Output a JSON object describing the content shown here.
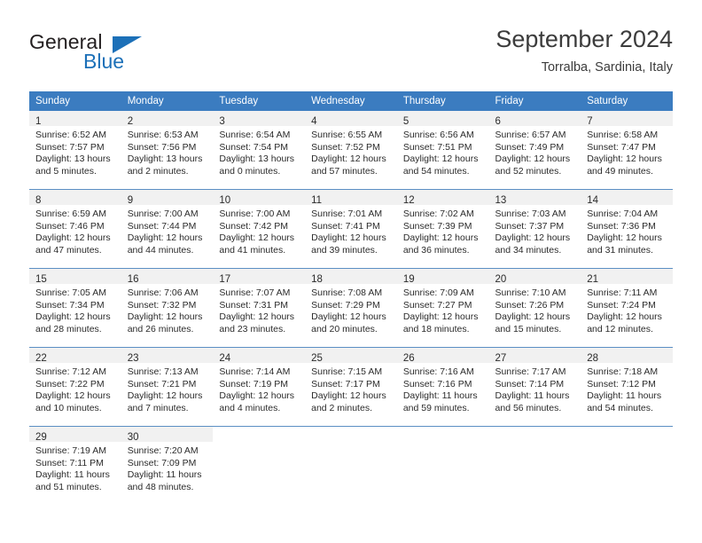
{
  "brand": {
    "name_part1": "General",
    "name_part2": "Blue",
    "triangle_icon": "triangle-icon",
    "accent_color": "#1c70b8"
  },
  "header": {
    "title": "September 2024",
    "subtitle": "Torralba, Sardinia, Italy"
  },
  "theme": {
    "header_blue": "#3b7cc0",
    "daynum_band": "#f1f1f1",
    "row_border": "#5b8fc4"
  },
  "weekdays": [
    "Sunday",
    "Monday",
    "Tuesday",
    "Wednesday",
    "Thursday",
    "Friday",
    "Saturday"
  ],
  "weeks": [
    [
      {
        "day": "1",
        "sunrise": "Sunrise: 6:52 AM",
        "sunset": "Sunset: 7:57 PM",
        "daylight1": "Daylight: 13 hours",
        "daylight2": "and 5 minutes."
      },
      {
        "day": "2",
        "sunrise": "Sunrise: 6:53 AM",
        "sunset": "Sunset: 7:56 PM",
        "daylight1": "Daylight: 13 hours",
        "daylight2": "and 2 minutes."
      },
      {
        "day": "3",
        "sunrise": "Sunrise: 6:54 AM",
        "sunset": "Sunset: 7:54 PM",
        "daylight1": "Daylight: 13 hours",
        "daylight2": "and 0 minutes."
      },
      {
        "day": "4",
        "sunrise": "Sunrise: 6:55 AM",
        "sunset": "Sunset: 7:52 PM",
        "daylight1": "Daylight: 12 hours",
        "daylight2": "and 57 minutes."
      },
      {
        "day": "5",
        "sunrise": "Sunrise: 6:56 AM",
        "sunset": "Sunset: 7:51 PM",
        "daylight1": "Daylight: 12 hours",
        "daylight2": "and 54 minutes."
      },
      {
        "day": "6",
        "sunrise": "Sunrise: 6:57 AM",
        "sunset": "Sunset: 7:49 PM",
        "daylight1": "Daylight: 12 hours",
        "daylight2": "and 52 minutes."
      },
      {
        "day": "7",
        "sunrise": "Sunrise: 6:58 AM",
        "sunset": "Sunset: 7:47 PM",
        "daylight1": "Daylight: 12 hours",
        "daylight2": "and 49 minutes."
      }
    ],
    [
      {
        "day": "8",
        "sunrise": "Sunrise: 6:59 AM",
        "sunset": "Sunset: 7:46 PM",
        "daylight1": "Daylight: 12 hours",
        "daylight2": "and 47 minutes."
      },
      {
        "day": "9",
        "sunrise": "Sunrise: 7:00 AM",
        "sunset": "Sunset: 7:44 PM",
        "daylight1": "Daylight: 12 hours",
        "daylight2": "and 44 minutes."
      },
      {
        "day": "10",
        "sunrise": "Sunrise: 7:00 AM",
        "sunset": "Sunset: 7:42 PM",
        "daylight1": "Daylight: 12 hours",
        "daylight2": "and 41 minutes."
      },
      {
        "day": "11",
        "sunrise": "Sunrise: 7:01 AM",
        "sunset": "Sunset: 7:41 PM",
        "daylight1": "Daylight: 12 hours",
        "daylight2": "and 39 minutes."
      },
      {
        "day": "12",
        "sunrise": "Sunrise: 7:02 AM",
        "sunset": "Sunset: 7:39 PM",
        "daylight1": "Daylight: 12 hours",
        "daylight2": "and 36 minutes."
      },
      {
        "day": "13",
        "sunrise": "Sunrise: 7:03 AM",
        "sunset": "Sunset: 7:37 PM",
        "daylight1": "Daylight: 12 hours",
        "daylight2": "and 34 minutes."
      },
      {
        "day": "14",
        "sunrise": "Sunrise: 7:04 AM",
        "sunset": "Sunset: 7:36 PM",
        "daylight1": "Daylight: 12 hours",
        "daylight2": "and 31 minutes."
      }
    ],
    [
      {
        "day": "15",
        "sunrise": "Sunrise: 7:05 AM",
        "sunset": "Sunset: 7:34 PM",
        "daylight1": "Daylight: 12 hours",
        "daylight2": "and 28 minutes."
      },
      {
        "day": "16",
        "sunrise": "Sunrise: 7:06 AM",
        "sunset": "Sunset: 7:32 PM",
        "daylight1": "Daylight: 12 hours",
        "daylight2": "and 26 minutes."
      },
      {
        "day": "17",
        "sunrise": "Sunrise: 7:07 AM",
        "sunset": "Sunset: 7:31 PM",
        "daylight1": "Daylight: 12 hours",
        "daylight2": "and 23 minutes."
      },
      {
        "day": "18",
        "sunrise": "Sunrise: 7:08 AM",
        "sunset": "Sunset: 7:29 PM",
        "daylight1": "Daylight: 12 hours",
        "daylight2": "and 20 minutes."
      },
      {
        "day": "19",
        "sunrise": "Sunrise: 7:09 AM",
        "sunset": "Sunset: 7:27 PM",
        "daylight1": "Daylight: 12 hours",
        "daylight2": "and 18 minutes."
      },
      {
        "day": "20",
        "sunrise": "Sunrise: 7:10 AM",
        "sunset": "Sunset: 7:26 PM",
        "daylight1": "Daylight: 12 hours",
        "daylight2": "and 15 minutes."
      },
      {
        "day": "21",
        "sunrise": "Sunrise: 7:11 AM",
        "sunset": "Sunset: 7:24 PM",
        "daylight1": "Daylight: 12 hours",
        "daylight2": "and 12 minutes."
      }
    ],
    [
      {
        "day": "22",
        "sunrise": "Sunrise: 7:12 AM",
        "sunset": "Sunset: 7:22 PM",
        "daylight1": "Daylight: 12 hours",
        "daylight2": "and 10 minutes."
      },
      {
        "day": "23",
        "sunrise": "Sunrise: 7:13 AM",
        "sunset": "Sunset: 7:21 PM",
        "daylight1": "Daylight: 12 hours",
        "daylight2": "and 7 minutes."
      },
      {
        "day": "24",
        "sunrise": "Sunrise: 7:14 AM",
        "sunset": "Sunset: 7:19 PM",
        "daylight1": "Daylight: 12 hours",
        "daylight2": "and 4 minutes."
      },
      {
        "day": "25",
        "sunrise": "Sunrise: 7:15 AM",
        "sunset": "Sunset: 7:17 PM",
        "daylight1": "Daylight: 12 hours",
        "daylight2": "and 2 minutes."
      },
      {
        "day": "26",
        "sunrise": "Sunrise: 7:16 AM",
        "sunset": "Sunset: 7:16 PM",
        "daylight1": "Daylight: 11 hours",
        "daylight2": "and 59 minutes."
      },
      {
        "day": "27",
        "sunrise": "Sunrise: 7:17 AM",
        "sunset": "Sunset: 7:14 PM",
        "daylight1": "Daylight: 11 hours",
        "daylight2": "and 56 minutes."
      },
      {
        "day": "28",
        "sunrise": "Sunrise: 7:18 AM",
        "sunset": "Sunset: 7:12 PM",
        "daylight1": "Daylight: 11 hours",
        "daylight2": "and 54 minutes."
      }
    ],
    [
      {
        "day": "29",
        "sunrise": "Sunrise: 7:19 AM",
        "sunset": "Sunset: 7:11 PM",
        "daylight1": "Daylight: 11 hours",
        "daylight2": "and 51 minutes."
      },
      {
        "day": "30",
        "sunrise": "Sunrise: 7:20 AM",
        "sunset": "Sunset: 7:09 PM",
        "daylight1": "Daylight: 11 hours",
        "daylight2": "and 48 minutes."
      },
      {
        "day": "",
        "sunrise": "",
        "sunset": "",
        "daylight1": "",
        "daylight2": ""
      },
      {
        "day": "",
        "sunrise": "",
        "sunset": "",
        "daylight1": "",
        "daylight2": ""
      },
      {
        "day": "",
        "sunrise": "",
        "sunset": "",
        "daylight1": "",
        "daylight2": ""
      },
      {
        "day": "",
        "sunrise": "",
        "sunset": "",
        "daylight1": "",
        "daylight2": ""
      },
      {
        "day": "",
        "sunrise": "",
        "sunset": "",
        "daylight1": "",
        "daylight2": ""
      }
    ]
  ]
}
